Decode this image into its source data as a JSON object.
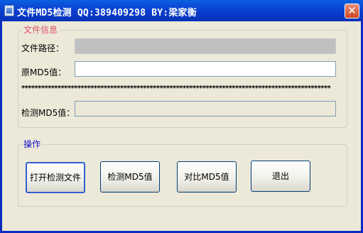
{
  "window": {
    "title": "文件MD5检测  QQ:389409298 BY:梁家衡",
    "close_glyph": "✕"
  },
  "file_info_group": {
    "legend": "文件信息",
    "path_label": "文件路径：",
    "path_value": "",
    "original_md5_label": "原MD5值：",
    "original_md5_value": "",
    "separator": "**********************************************************************************************",
    "detected_md5_label": "检测MD5值：",
    "detected_md5_value": ""
  },
  "actions_group": {
    "legend": "操作",
    "open_button": "打开检测文件",
    "detect_button": "检测MD5值",
    "compare_button": "对比MD5值",
    "exit_button": "退出"
  }
}
